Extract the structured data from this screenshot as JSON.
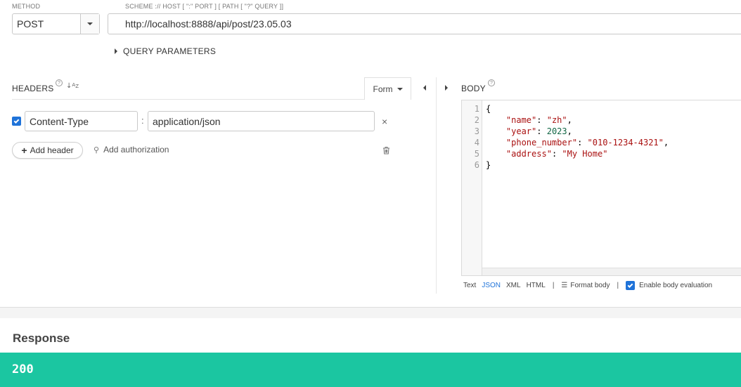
{
  "request": {
    "method_label": "METHOD",
    "method": "POST",
    "url_label": "SCHEME :// HOST [ \":\" PORT ] [ PATH [ \"?\" QUERY ]]",
    "url": "http://localhost:8888/api/post/23.05.03",
    "query_params_label": "QUERY PARAMETERS"
  },
  "headers": {
    "title": "HEADERS",
    "form_label": "Form",
    "items": [
      {
        "enabled": true,
        "name": "Content-Type",
        "value": "application/json"
      }
    ],
    "add_header_label": "Add header",
    "add_auth_label": "Add authorization"
  },
  "body": {
    "title": "BODY",
    "line_numbers": [
      "1",
      "2",
      "3",
      "4",
      "5",
      "6"
    ],
    "code_lines": [
      "{",
      "    \"name\": \"zh\",",
      "    \"year\": 2023,",
      "    \"phone_number\": \"010-1234-4321\",",
      "    \"address\": \"My Home\"",
      "}"
    ],
    "formats": [
      "Text",
      "JSON",
      "XML",
      "HTML"
    ],
    "active_format": "JSON",
    "format_body_label": "Format body",
    "enable_eval_label": "Enable body evaluation",
    "enable_eval": true
  },
  "response": {
    "title": "Response",
    "status_code": "200",
    "status_color": "#1bc6a1"
  },
  "icons": {
    "help": "question-circle-icon",
    "sort": "sort-alpha-icon",
    "remove": "close-icon",
    "trash": "trash-icon",
    "key": "key-icon",
    "format": "format-lines-icon"
  },
  "colors": {
    "accent": "#1f73d9",
    "status_ok": "#1bc6a1"
  }
}
